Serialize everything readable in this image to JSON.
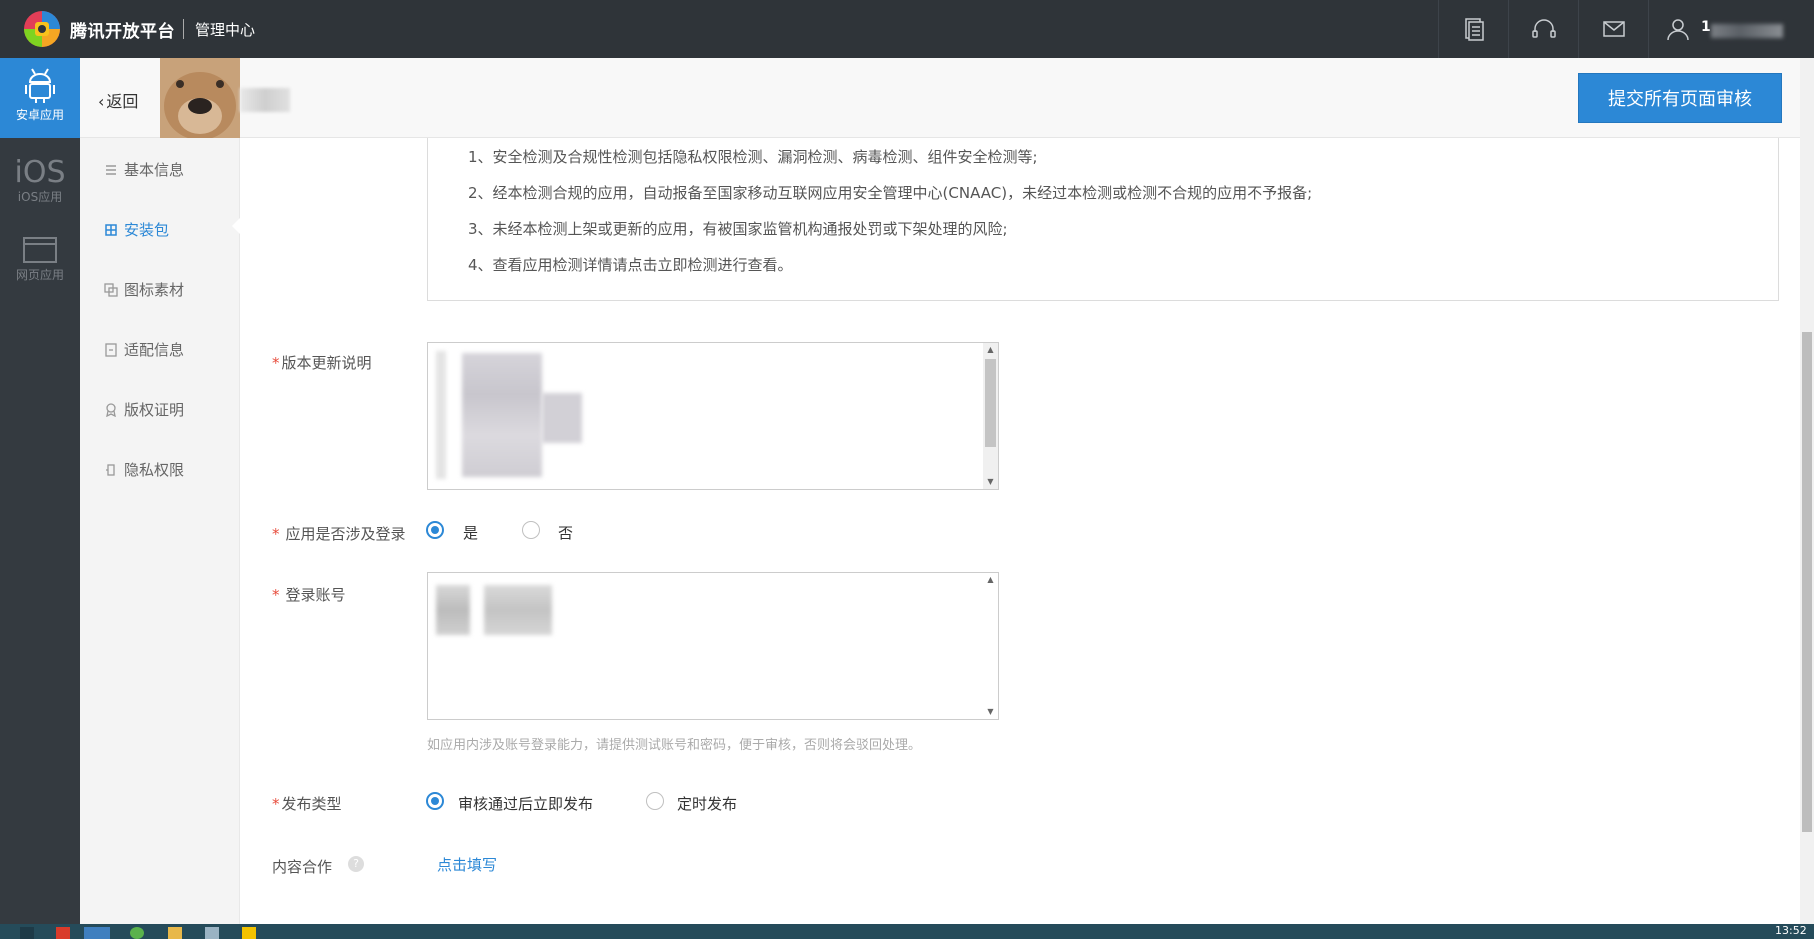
{
  "topbar": {
    "brand": "腾讯开放平台",
    "subtitle": "管理中心",
    "user": "1"
  },
  "sidebar": {
    "items": [
      {
        "label": "安卓应用",
        "icon": "android-icon",
        "active": true
      },
      {
        "label": "iOS应用",
        "icon_text": "iOS",
        "active": false
      },
      {
        "label": "网页应用",
        "icon": "browser-window-icon",
        "active": false
      }
    ]
  },
  "subheader": {
    "back_label": "返回",
    "submit_label": "提交所有页面审核"
  },
  "nav": {
    "items": [
      {
        "label": "基本信息",
        "icon": "list-icon"
      },
      {
        "label": "安装包",
        "icon": "grid-icon",
        "active": true
      },
      {
        "label": "图标素材",
        "icon": "image-icon"
      },
      {
        "label": "适配信息",
        "icon": "doc-icon"
      },
      {
        "label": "版权证明",
        "icon": "award-icon"
      },
      {
        "label": "隐私权限",
        "icon": "lock-icon"
      }
    ]
  },
  "notice": {
    "lines": [
      "1、安全检测及合规性检测包括隐私权限检测、漏洞检测、病毒检测、组件安全检测等;",
      "2、经本检测合规的应用，自动报备至国家移动互联网应用安全管理中心(CNAAC)，未经过本检测或检测不合规的应用不予报备;",
      "3、未经本检测上架或更新的应用，有被国家监管机构通报处罚或下架处理的风险;",
      "4、查看应用检测详情请点击立即检测进行查看。"
    ]
  },
  "form": {
    "update_notes_label": "版本更新说明",
    "login_question_label": "应用是否涉及登录",
    "login_yes": "是",
    "login_no": "否",
    "login_selected": "是",
    "account_label": "登录账号",
    "account_hint": "如应用内涉及账号登录能力，请提供测试账号和密码，便于审核，否则将会驳回处理。",
    "publish_type_label": "发布类型",
    "publish_immediate": "审核通过后立即发布",
    "publish_scheduled": "定时发布",
    "publish_selected": "审核通过后立即发布",
    "content_coop_label": "内容合作",
    "content_coop_link": "点击填写",
    "required_mark": "*"
  },
  "taskbar": {
    "time": "13:52"
  },
  "colors": {
    "accent": "#2c88d6",
    "topbar": "#2f3439",
    "sidebar": "#343a40",
    "required": "#e74c3c"
  }
}
